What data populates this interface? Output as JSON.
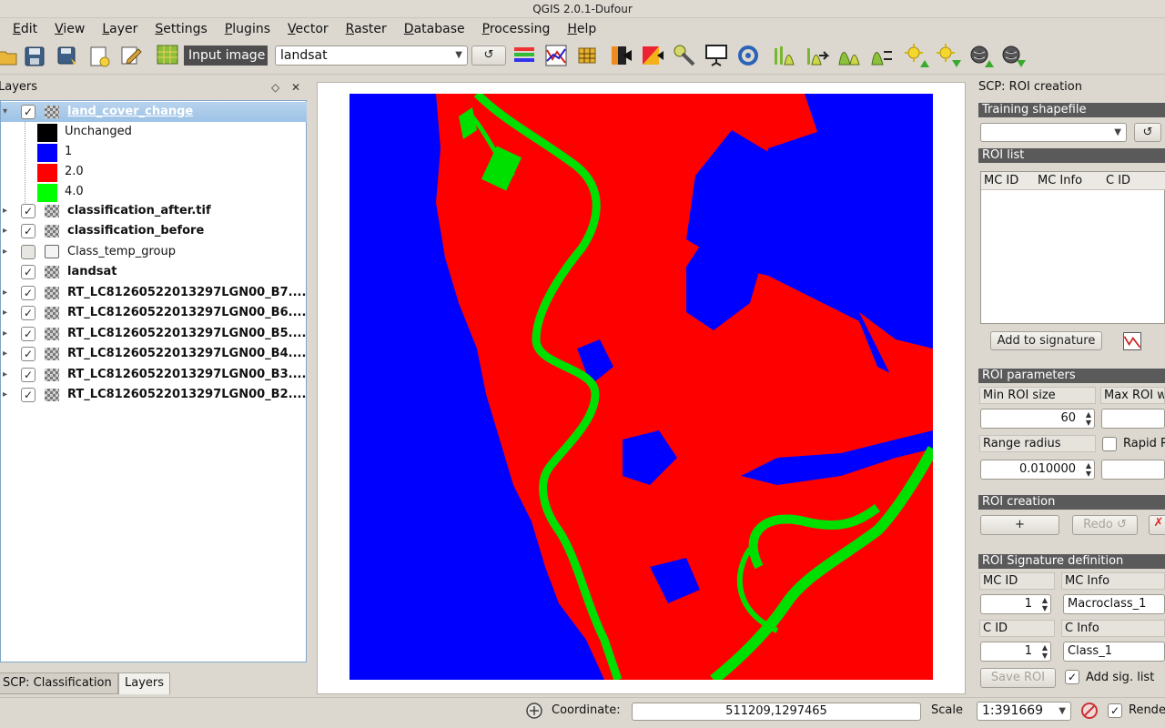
{
  "window": {
    "title": "QGIS 2.0.1-Dufour"
  },
  "menu": [
    "Edit",
    "View",
    "Layer",
    "Settings",
    "Plugins",
    "Vector",
    "Raster",
    "Database",
    "Processing",
    "Help"
  ],
  "toolbar": {
    "input_image_label": "Input image",
    "input_image_value": "landsat",
    "refresh_label": "↺"
  },
  "layers_panel": {
    "title": "Layers",
    "layers": [
      {
        "name": "land_cover_change",
        "checked": true,
        "selected": true
      },
      {
        "name": "classification_after.tif",
        "checked": true
      },
      {
        "name": "classification_before",
        "checked": true
      },
      {
        "name": "Class_temp_group",
        "checked": false,
        "group": true
      },
      {
        "name": "landsat",
        "checked": true
      },
      {
        "name": "RT_LC81260522013297LGN00_B7....",
        "checked": true
      },
      {
        "name": "RT_LC81260522013297LGN00_B6....",
        "checked": true
      },
      {
        "name": "RT_LC81260522013297LGN00_B5....",
        "checked": true
      },
      {
        "name": "RT_LC81260522013297LGN00_B4....",
        "checked": true
      },
      {
        "name": "RT_LC81260522013297LGN00_B3....",
        "checked": true
      },
      {
        "name": "RT_LC81260522013297LGN00_B2....",
        "checked": true
      }
    ],
    "legend": [
      {
        "label": "Unchanged",
        "color": "#000000"
      },
      {
        "label": "1",
        "color": "#0000ff"
      },
      {
        "label": "2.0",
        "color": "#ff0000"
      },
      {
        "label": "4.0",
        "color": "#00ff00"
      }
    ]
  },
  "bottom_tabs": [
    "SCP: Classification",
    "Layers"
  ],
  "scp": {
    "title": "SCP: ROI creation",
    "training_shapefile": "Training shapefile",
    "refresh": "↺",
    "roi_list": "ROI list",
    "roi_columns": [
      "MC ID",
      "MC Info",
      "C ID"
    ],
    "add_to_signature": "Add to signature",
    "roi_parameters": "ROI parameters",
    "min_roi_size_label": "Min ROI size",
    "max_roi_label": "Max ROI w",
    "min_roi_size": "60",
    "range_radius_label": "Range radius",
    "rapid_label": "Rapid R",
    "range_radius": "0.010000",
    "roi_creation": "ROI creation",
    "plus": "+",
    "redo": "Redo ↺",
    "signature_definition": "ROI Signature definition",
    "mc_id_label": "MC ID",
    "mc_info_label": "MC Info",
    "mc_id": "1",
    "mc_info": "Macroclass_1",
    "c_id_label": "C ID",
    "c_info_label": "C Info",
    "c_id": "1",
    "c_info": "Class_1",
    "save_roi": "Save ROI",
    "add_sig_list": "Add sig. list"
  },
  "statusbar": {
    "coordinate_label": "Coordinate:",
    "coordinate": "511209,1297465",
    "scale_label": "Scale",
    "scale": "1:391669",
    "render_label": "Rende"
  },
  "colors": {
    "water": "#0000ff",
    "changed": "#ff0000",
    "river": "#00ee00",
    "selection": "#9ec3e6"
  }
}
